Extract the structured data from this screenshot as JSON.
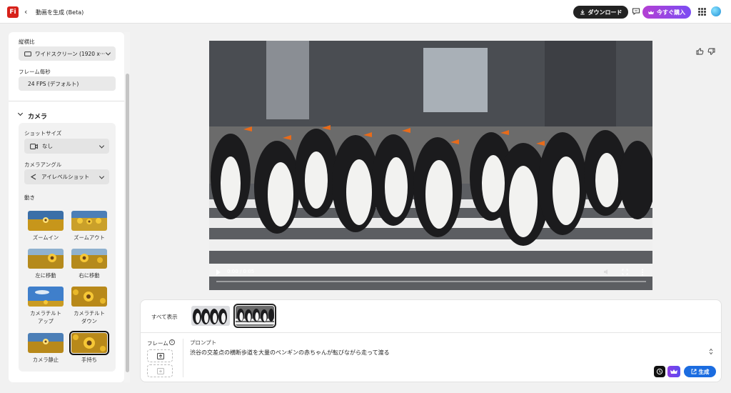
{
  "header": {
    "logo_text": "Fi",
    "back_glyph": "‹",
    "title": "動画を生成 (Beta)",
    "download_label": "ダウンロード",
    "buy_label": "今すぐ購入"
  },
  "settings": {
    "aspect_label": "縦横比",
    "aspect_value": "ワイドスクリーン (1920 x···",
    "fps_label": "フレーム毎秒",
    "fps_value": "24 FPS (デフォルト)",
    "camera_heading": "カメラ",
    "shot_size_label": "ショットサイズ",
    "shot_size_value": "なし",
    "camera_angle_label": "カメラアングル",
    "camera_angle_value": "アイレベルショット",
    "motion_label": "動き",
    "motions": [
      {
        "label": "ズームイン"
      },
      {
        "label": "ズームアウト"
      },
      {
        "label": "左に移動"
      },
      {
        "label": "右に移動"
      },
      {
        "label": "カメラチルト\nアップ"
      },
      {
        "label": "カメラチルト\nダウン"
      },
      {
        "label": "カメラ静止"
      },
      {
        "label": "手持ち",
        "selected": true
      }
    ]
  },
  "player": {
    "time": "0:00 / 0:05",
    "progress": 0
  },
  "bottom": {
    "show_all_label": "すべて表示",
    "frame_label": "フレーム",
    "prompt_label": "プロンプト",
    "prompt_text": "渋谷の交差点の横断歩道を大量のペンギンの赤ちゃんが転びながら走って渡る",
    "generate_label": "生成"
  },
  "colors": {
    "accent": "#1b6ce0",
    "buy_gradient_start": "#b43fd3",
    "buy_gradient_end": "#7a4cf3",
    "logo": "#d7211a"
  }
}
